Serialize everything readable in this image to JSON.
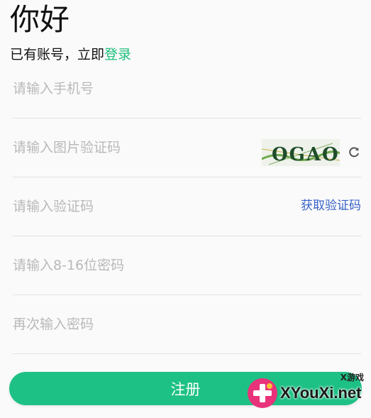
{
  "header": {
    "greeting": "你好",
    "login_prompt": "已有账号，立即",
    "login_link": "登录"
  },
  "form": {
    "phone_placeholder": "请输入手机号",
    "image_code_placeholder": "请输入图片验证码",
    "captcha_text": "OGAO",
    "sms_code_placeholder": "请输入验证码",
    "get_code_label": "获取验证码",
    "password_placeholder": "请输入8-16位密码",
    "confirm_password_placeholder": "再次输入密码",
    "submit_label": "注册"
  },
  "watermark": {
    "site": "XYouXi.net",
    "tag": "X游戏"
  },
  "colors": {
    "accent": "#1ec185",
    "link": "#1cbf7c",
    "get_code": "#3a63c9",
    "placeholder": "#b9b9b9"
  },
  "icons": [
    "refresh-icon",
    "watermark-logo-icon"
  ]
}
